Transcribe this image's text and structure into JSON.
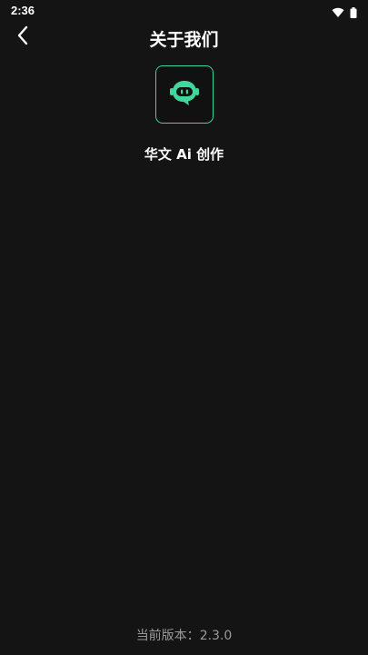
{
  "status_bar": {
    "time": "2:36",
    "icons": [
      "wifi-icon",
      "battery-icon"
    ]
  },
  "header": {
    "back_icon": "chevron-left-icon",
    "title": "关于我们"
  },
  "app": {
    "logo_icon": "chat-bubble-face-icon",
    "name": "华文 Ai 创作"
  },
  "footer": {
    "version_label": "当前版本：",
    "version_value": "2.3.0"
  },
  "colors": {
    "background": "#141414",
    "accent": "#3fd79b",
    "text_primary": "#ffffff",
    "text_secondary": "#9a9a9a"
  }
}
